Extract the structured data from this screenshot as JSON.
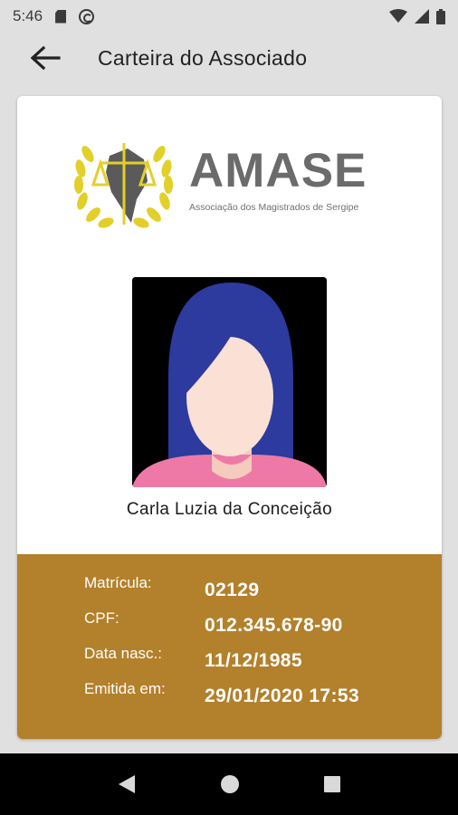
{
  "status_bar": {
    "time": "5:46"
  },
  "app_bar": {
    "title": "Carteira do Associado"
  },
  "logo": {
    "name": "AMASE",
    "subtitle": "Associação dos Magistrados de Sergipe"
  },
  "member": {
    "name": "Carla Luzia da Conceição"
  },
  "details": [
    {
      "label": "Matrícula:",
      "value": "02129"
    },
    {
      "label": "CPF:",
      "value": "012.345.678-90"
    },
    {
      "label": "Data nasc.:",
      "value": "11/12/1985"
    },
    {
      "label": "Emitida em:",
      "value": "29/01/2020 17:53"
    }
  ],
  "colors": {
    "accent": "#b3802b",
    "logo_gold": "#e3cf2a",
    "logo_gray": "#6b6b6b"
  }
}
